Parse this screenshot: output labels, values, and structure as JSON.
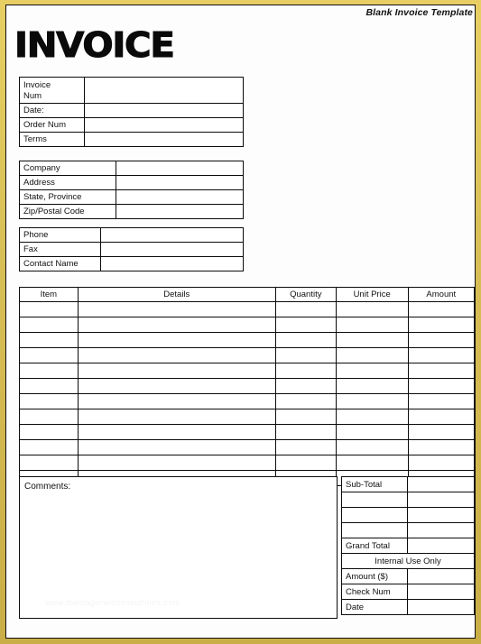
{
  "page": {
    "caption": "Blank Invoice Template",
    "title": "INVOICE",
    "border_color": "#d8bf55",
    "paper_color": "#fdfdfd",
    "line_color": "#0b0b0b",
    "watermark": "www.thestagerwishesoutlines.com"
  },
  "invoice_block": {
    "rows": [
      {
        "label": "Invoice\nNum",
        "value": ""
      },
      {
        "label": "Date:",
        "value": ""
      },
      {
        "label": "Order Num",
        "value": ""
      },
      {
        "label": "Terms",
        "value": ""
      }
    ]
  },
  "company_block": {
    "rows": [
      {
        "label": "Company",
        "value": ""
      },
      {
        "label": "Address",
        "value": ""
      },
      {
        "label": "State, Province",
        "value": ""
      },
      {
        "label": "Zip/Postal Code",
        "value": ""
      }
    ]
  },
  "contact_block": {
    "rows": [
      {
        "label": "Phone",
        "value": ""
      },
      {
        "label": "Fax",
        "value": ""
      },
      {
        "label": "Contact Name",
        "value": ""
      }
    ]
  },
  "items_table": {
    "columns": [
      "Item",
      "Details",
      "Quantity",
      "Unit Price",
      "Amount"
    ],
    "row_count": 12,
    "rows": [
      {
        "item": "",
        "details": "",
        "quantity": "",
        "unit_price": "",
        "amount": ""
      },
      {
        "item": "",
        "details": "",
        "quantity": "",
        "unit_price": "",
        "amount": ""
      },
      {
        "item": "",
        "details": "",
        "quantity": "",
        "unit_price": "",
        "amount": ""
      },
      {
        "item": "",
        "details": "",
        "quantity": "",
        "unit_price": "",
        "amount": ""
      },
      {
        "item": "",
        "details": "",
        "quantity": "",
        "unit_price": "",
        "amount": ""
      },
      {
        "item": "",
        "details": "",
        "quantity": "",
        "unit_price": "",
        "amount": ""
      },
      {
        "item": "",
        "details": "",
        "quantity": "",
        "unit_price": "",
        "amount": ""
      },
      {
        "item": "",
        "details": "",
        "quantity": "",
        "unit_price": "",
        "amount": ""
      },
      {
        "item": "",
        "details": "",
        "quantity": "",
        "unit_price": "",
        "amount": ""
      },
      {
        "item": "",
        "details": "",
        "quantity": "",
        "unit_price": "",
        "amount": ""
      },
      {
        "item": "",
        "details": "",
        "quantity": "",
        "unit_price": "",
        "amount": ""
      },
      {
        "item": "",
        "details": "",
        "quantity": "",
        "unit_price": "",
        "amount": ""
      }
    ]
  },
  "comments": {
    "label": "Comments:",
    "value": ""
  },
  "totals": {
    "rows": [
      {
        "label": "Sub-Total",
        "value": "",
        "span": false
      },
      {
        "label": "",
        "value": "",
        "span": false
      },
      {
        "label": "",
        "value": "",
        "span": false
      },
      {
        "label": "",
        "value": "",
        "span": false
      },
      {
        "label": "Grand Total",
        "value": "",
        "span": false
      },
      {
        "label": "Internal Use Only",
        "value": "",
        "span": true
      },
      {
        "label": "Amount ($)",
        "value": "",
        "span": false
      },
      {
        "label": "Check Num",
        "value": "",
        "span": false
      },
      {
        "label": "Date",
        "value": "",
        "span": false
      }
    ]
  }
}
